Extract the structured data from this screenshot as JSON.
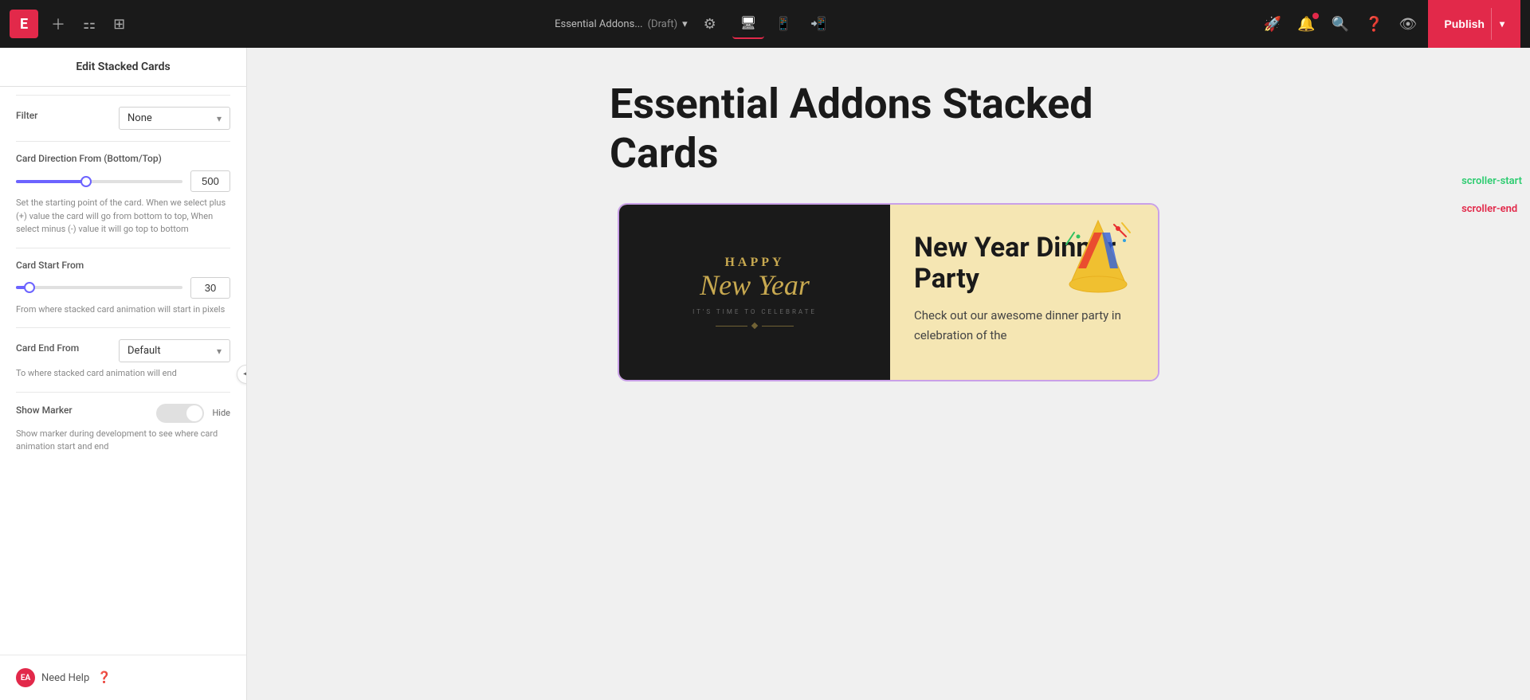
{
  "topbar": {
    "logo_text": "E",
    "site_name": "Essential Addons...",
    "site_status": "(Draft)",
    "settings_icon": "⚙",
    "publish_label": "Publish",
    "devices": [
      "desktop",
      "tablet",
      "mobile"
    ],
    "active_device": "desktop"
  },
  "sidebar": {
    "title": "Edit Stacked Cards",
    "fields": {
      "filter": {
        "label": "Filter",
        "value": "None"
      },
      "card_direction": {
        "label": "Card Direction From (Bottom/Top)",
        "slider_value": 500,
        "slider_pct": 42,
        "hint": "Set the starting point of the card. When we select plus (+) value the card will go from bottom to top, When select minus (-) value it will go top to bottom"
      },
      "card_start_from": {
        "label": "Card Start From",
        "slider_value": 30,
        "slider_pct": 8,
        "hint": "From where stacked card animation will start in pixels"
      },
      "card_end_from": {
        "label": "Card End From",
        "value": "Default"
      },
      "card_end_hint": "To where stacked card animation will end",
      "show_marker": {
        "label": "Show Marker",
        "toggle_label": "Hide",
        "hint": "Show marker during development to see where card animation start and end"
      }
    },
    "need_help": {
      "label": "Need Help",
      "logo": "EA"
    }
  },
  "canvas": {
    "page_title": "Essential Addons Stacked Cards",
    "card": {
      "bg_color": "#f5e6b3",
      "image_bg": "#1a1a1a",
      "image_title_line1": "HAPPY",
      "image_title_line2": "New Year",
      "image_tagline": "IT'S TIME TO CELEBRATE",
      "content_title": "New Year Dinner Party",
      "content_text": "Check out our awesome dinner party in celebration of the"
    }
  },
  "markers": {
    "start_label": "scroller-start",
    "end_label": "scroller-end"
  }
}
